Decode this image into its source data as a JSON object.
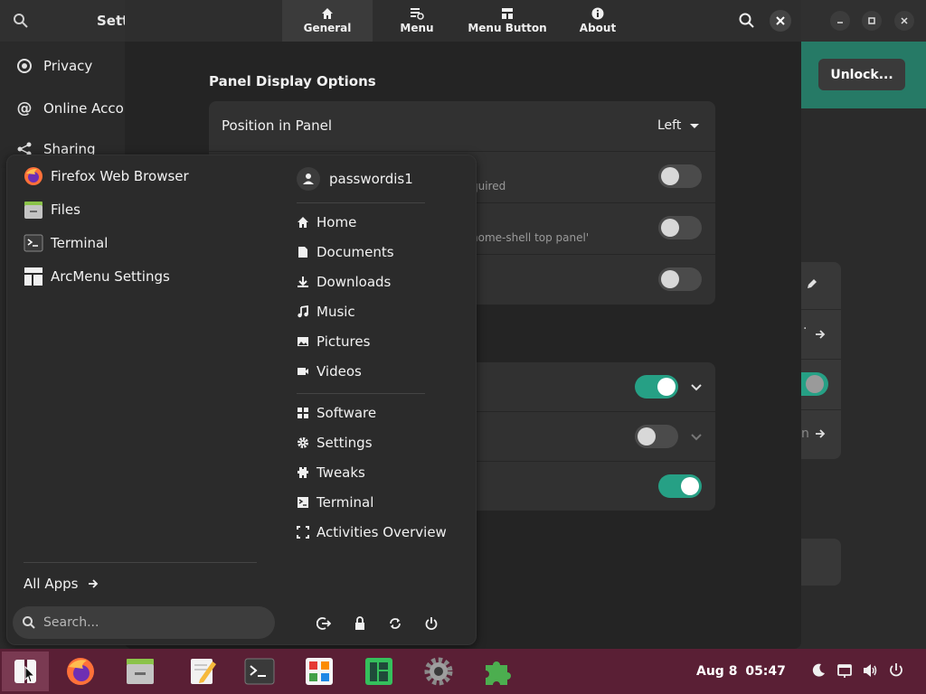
{
  "settings": {
    "title": "Sett",
    "sidebar": [
      {
        "label": "Privacy",
        "icon": "privacy-icon"
      },
      {
        "label": "Online Accou",
        "icon": "at-icon"
      },
      {
        "label": "Sharing",
        "icon": "sharing-icon"
      }
    ],
    "unlock_label": "Unlock...",
    "right_rows_tail": [
      "n"
    ]
  },
  "dialog": {
    "tabs": [
      {
        "label": "General",
        "icon": "home-icon",
        "active": true
      },
      {
        "label": "Menu",
        "icon": "menu-settings-icon",
        "active": false
      },
      {
        "label": "Menu Button",
        "icon": "menu-button-icon",
        "active": false
      },
      {
        "label": "About",
        "icon": "info-icon",
        "active": false
      }
    ],
    "section_title": "Panel Display Options",
    "position_label": "Position in Panel",
    "position_value": "Left",
    "row2_sub": "quired",
    "row3_sub": "nome-shell top panel'",
    "toggles": {
      "row2": false,
      "row3": false,
      "row4": false,
      "row5": true,
      "row6": false,
      "row7": true
    }
  },
  "arcmenu": {
    "favorites": [
      {
        "label": "Firefox Web Browser",
        "icon": "firefox-icon"
      },
      {
        "label": "Files",
        "icon": "files-icon"
      },
      {
        "label": "Terminal",
        "icon": "terminal-icon"
      },
      {
        "label": "ArcMenu Settings",
        "icon": "arcmenu-settings-icon"
      }
    ],
    "all_apps": "All Apps",
    "search_placeholder": "Search...",
    "user": "passwordis1",
    "places": [
      {
        "label": "Home",
        "icon": "home-icon"
      },
      {
        "label": "Documents",
        "icon": "document-icon"
      },
      {
        "label": "Downloads",
        "icon": "download-icon"
      },
      {
        "label": "Music",
        "icon": "music-icon"
      },
      {
        "label": "Pictures",
        "icon": "pictures-icon"
      },
      {
        "label": "Videos",
        "icon": "videos-icon"
      }
    ],
    "shortcuts": [
      {
        "label": "Software",
        "icon": "software-icon"
      },
      {
        "label": "Settings",
        "icon": "gear-icon"
      },
      {
        "label": "Tweaks",
        "icon": "tweaks-icon"
      },
      {
        "label": "Terminal",
        "icon": "terminal-icon"
      },
      {
        "label": "Activities Overview",
        "icon": "activities-icon"
      }
    ],
    "power_buttons": [
      "logout-icon",
      "lock-icon",
      "restart-icon",
      "power-icon"
    ]
  },
  "taskbar": {
    "clock_date": "Aug 8",
    "clock_time": "05:47",
    "dock": [
      "arcmenu-button",
      "firefox",
      "files",
      "text-editor",
      "terminal",
      "software",
      "manjaro-hello",
      "settings",
      "extensions"
    ]
  }
}
